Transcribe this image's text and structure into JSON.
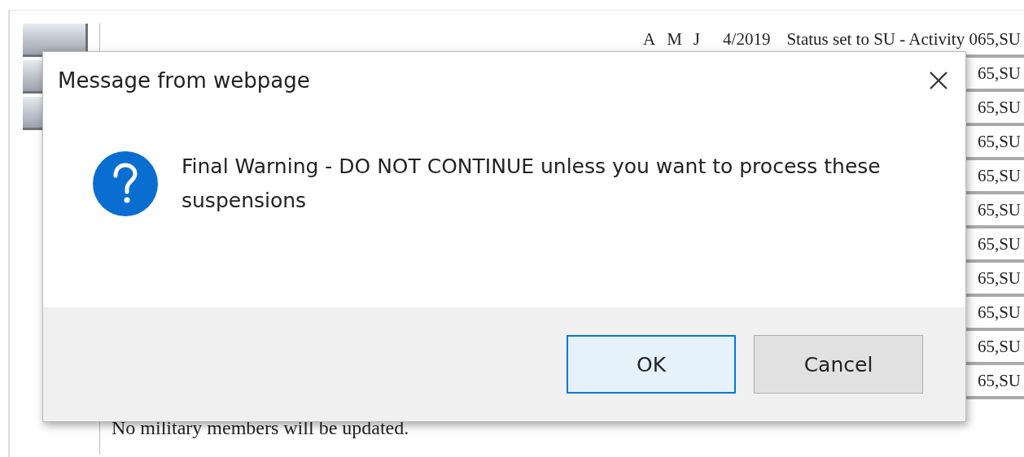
{
  "page": {
    "header_row": [
      "A",
      "M",
      "J",
      "4/2019",
      "Status set to SU - Activity 065,SU"
    ],
    "rows": [
      "65,SU",
      "65,SU",
      "65,SU",
      "65,SU",
      "65,SU",
      "65,SU",
      "65,SU",
      "65,SU",
      "65,SU",
      "65,SU"
    ],
    "note": "No military members will be updated."
  },
  "dialog": {
    "title": "Message from webpage",
    "message": "Final Warning - DO NOT CONTINUE unless you want to process these suspensions",
    "buttons": [
      {
        "label": "OK",
        "default": true
      },
      {
        "label": "Cancel",
        "default": false
      }
    ]
  }
}
